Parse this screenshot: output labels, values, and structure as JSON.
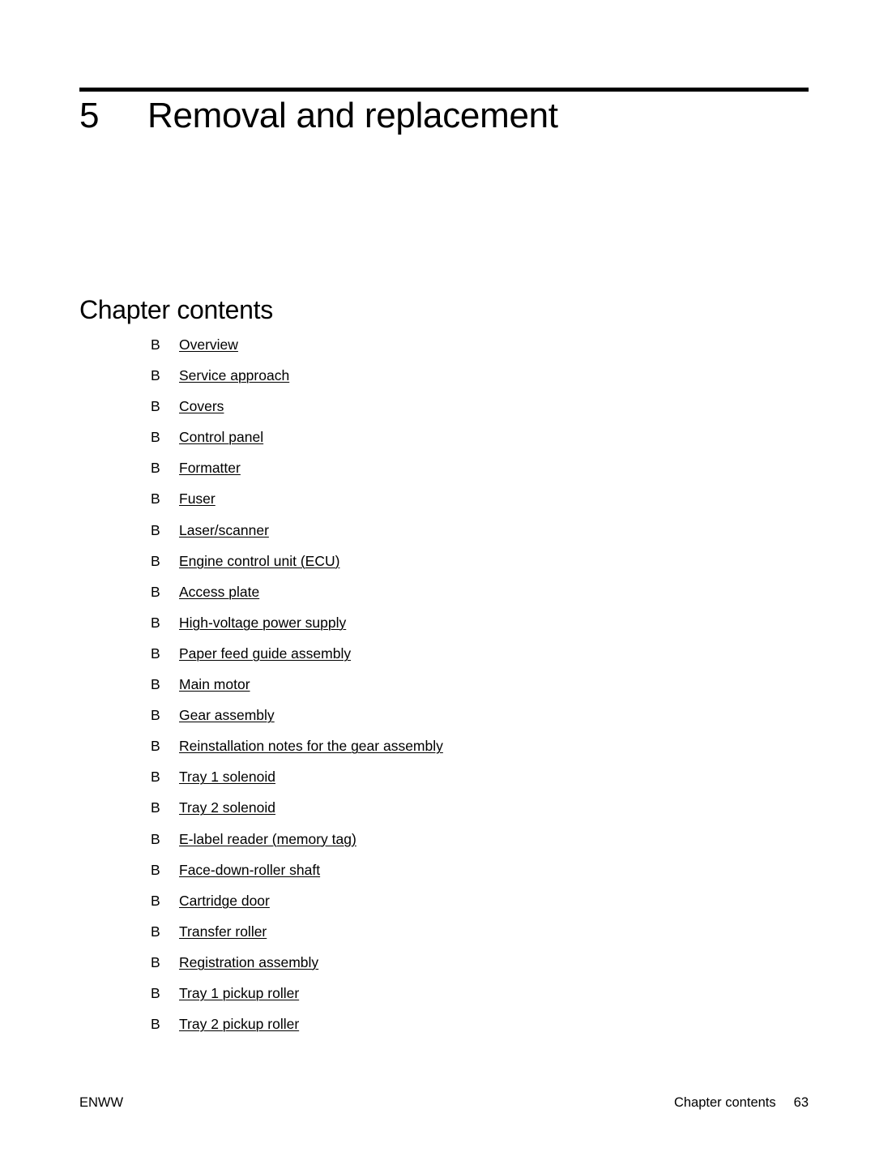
{
  "chapter": {
    "number": "5",
    "title": "Removal and replacement"
  },
  "section": {
    "heading": "Chapter contents",
    "bullet": "B",
    "items": [
      {
        "label": "Overview"
      },
      {
        "label": "Service approach"
      },
      {
        "label": "Covers"
      },
      {
        "label": "Control panel"
      },
      {
        "label": "Formatter"
      },
      {
        "label": "Fuser"
      },
      {
        "label": "Laser/scanner"
      },
      {
        "label": "Engine control unit (ECU)"
      },
      {
        "label": "Access plate"
      },
      {
        "label": "High-voltage power supply"
      },
      {
        "label": "Paper feed guide assembly"
      },
      {
        "label": "Main motor"
      },
      {
        "label": "Gear assembly"
      },
      {
        "label": "Reinstallation notes for the gear assembly"
      },
      {
        "label": "Tray 1 solenoid"
      },
      {
        "label": "Tray 2 solenoid"
      },
      {
        "label": "E-label reader (memory tag)"
      },
      {
        "label": "Face-down-roller shaft"
      },
      {
        "label": "Cartridge door"
      },
      {
        "label": "Transfer roller"
      },
      {
        "label": "Registration assembly"
      },
      {
        "label": "Tray 1 pickup roller"
      },
      {
        "label": "Tray 2 pickup roller"
      }
    ]
  },
  "footer": {
    "left": "ENWW",
    "section_name": "Chapter contents",
    "page_number": "63"
  }
}
